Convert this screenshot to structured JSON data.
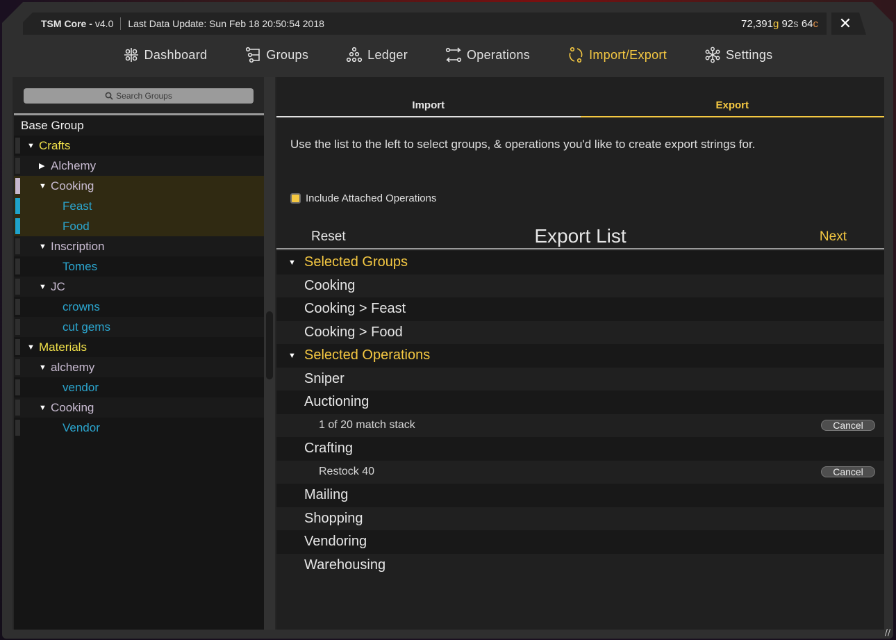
{
  "titlebar": {
    "app_name": "TSM Core -",
    "version": "v4.0",
    "last_update": "Last Data Update: Sun Feb 18 20:50:54 2018",
    "money": {
      "gold": "72,391",
      "gold_unit": "g",
      "silver": "92",
      "silver_unit": "s",
      "copper": "64",
      "copper_unit": "c"
    },
    "close_label": "✕"
  },
  "nav": {
    "items": [
      {
        "label": "Dashboard",
        "icon": "dashboard-icon"
      },
      {
        "label": "Groups",
        "icon": "groups-icon"
      },
      {
        "label": "Ledger",
        "icon": "ledger-icon"
      },
      {
        "label": "Operations",
        "icon": "operations-icon"
      },
      {
        "label": "Import/Export",
        "icon": "import-export-icon",
        "active": true
      },
      {
        "label": "Settings",
        "icon": "settings-icon"
      }
    ]
  },
  "sidebar": {
    "search_placeholder": "Search Groups",
    "tree": [
      {
        "label": "Base Group",
        "level": 0
      },
      {
        "label": "Crafts",
        "level": 1,
        "caret": "down"
      },
      {
        "label": "Alchemy",
        "level": 2,
        "caret": "right"
      },
      {
        "label": "Cooking",
        "level": 2,
        "caret": "down",
        "selected": true,
        "bar_color": "#c7b8cf"
      },
      {
        "label": "Feast",
        "level": 3,
        "selected": true,
        "bar_color": "#1fa3cc"
      },
      {
        "label": "Food",
        "level": 3,
        "selected": true,
        "bar_color": "#1fa3cc"
      },
      {
        "label": "Inscription",
        "level": 2,
        "caret": "down"
      },
      {
        "label": "Tomes",
        "level": 3
      },
      {
        "label": "JC",
        "level": 2,
        "caret": "down"
      },
      {
        "label": "crowns",
        "level": 3
      },
      {
        "label": "cut gems",
        "level": 3
      },
      {
        "label": "Materials",
        "level": 1,
        "caret": "down"
      },
      {
        "label": "alchemy",
        "level": 2,
        "caret": "down"
      },
      {
        "label": "vendor",
        "level": 3
      },
      {
        "label": "Cooking",
        "level": 2,
        "caret": "down"
      },
      {
        "label": "Vendor",
        "level": 3
      }
    ]
  },
  "main": {
    "tabs": [
      {
        "label": "Import"
      },
      {
        "label": "Export",
        "active": true
      }
    ],
    "description": "Use the list to the left to select groups, & operations you'd like to create export strings for.",
    "include_ops_label": "Include Attached Operations",
    "include_ops_checked": true,
    "reset_label": "Reset",
    "list_title": "Export List",
    "next_label": "Next",
    "rows": [
      {
        "type": "header",
        "label": "Selected Groups"
      },
      {
        "type": "item",
        "label": "Cooking"
      },
      {
        "type": "item",
        "label": "Cooking > Feast"
      },
      {
        "type": "item",
        "label": "Cooking > Food"
      },
      {
        "type": "header",
        "label": "Selected Operations"
      },
      {
        "type": "item",
        "label": "Sniper"
      },
      {
        "type": "item",
        "label": "Auctioning"
      },
      {
        "type": "sub",
        "label": "1 of 20 match stack",
        "action": "Cancel"
      },
      {
        "type": "item",
        "label": "Crafting"
      },
      {
        "type": "sub",
        "label": "Restock 40",
        "action": "Cancel"
      },
      {
        "type": "item",
        "label": "Mailing"
      },
      {
        "type": "item",
        "label": "Shopping"
      },
      {
        "type": "item",
        "label": "Vendoring"
      },
      {
        "type": "item",
        "label": "Warehousing"
      }
    ]
  },
  "colors": {
    "accent": "#f5c842",
    "group_blue": "#2ba6cf",
    "top_group": "#f1e14a"
  }
}
